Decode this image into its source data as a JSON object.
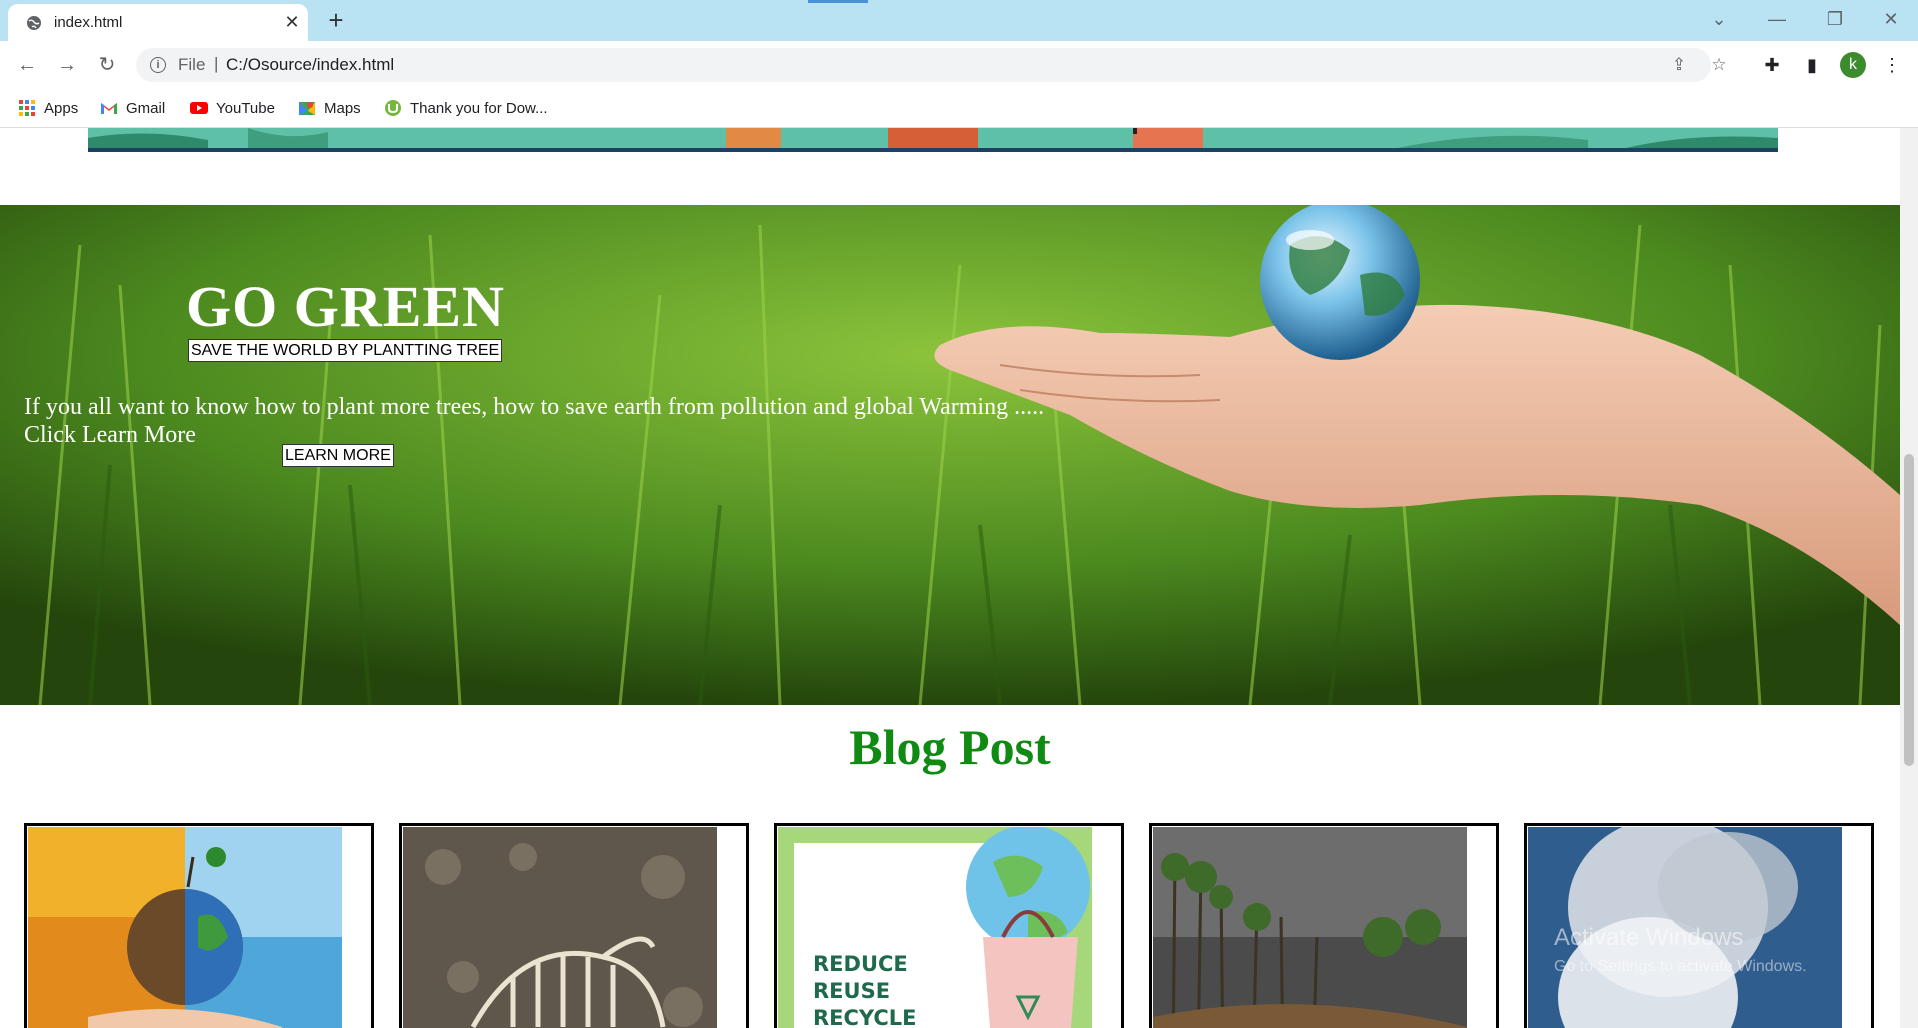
{
  "browser": {
    "tab_title": "index.html",
    "url_scheme": "File",
    "url_separator": "|",
    "url_path": "C:/Osource/index.html",
    "profile_initial": "k"
  },
  "bookmarks": [
    {
      "label": "Apps",
      "icon": "apps-grid-icon"
    },
    {
      "label": "Gmail",
      "icon": "gmail-icon"
    },
    {
      "label": "YouTube",
      "icon": "youtube-icon"
    },
    {
      "label": "Maps",
      "icon": "maps-icon"
    },
    {
      "label": "Thank you for Dow...",
      "icon": "utorrent-icon"
    }
  ],
  "hero": {
    "title": "GO GREEN",
    "subtitle_button": "SAVE THE WORLD BY PLANTTING TREE",
    "description": "If you all want to know how to plant more trees, how to save earth from pollution and global Warming .....",
    "description_line2": "Click Learn More",
    "cta_button": "LEARN MORE"
  },
  "blog": {
    "heading": "Blog Post",
    "cards": [
      {
        "image": "earth-split-fire-water-image",
        "text": ""
      },
      {
        "image": "dinosaur-fossil-image",
        "text": ""
      },
      {
        "image": "reduce-reuse-recycle-image",
        "text": "REDUCE REUSE RECYCLE"
      },
      {
        "image": "deforestation-image",
        "text": ""
      },
      {
        "image": "smokestack-pollution-image",
        "text": ""
      }
    ]
  },
  "watermark": {
    "line1": "Activate Windows",
    "line2": "Go to Settings to activate Windows."
  },
  "colors": {
    "tabstrip": "#b9e3f2",
    "blog_heading": "#0f8a12",
    "avatar": "#3c8b2d"
  }
}
